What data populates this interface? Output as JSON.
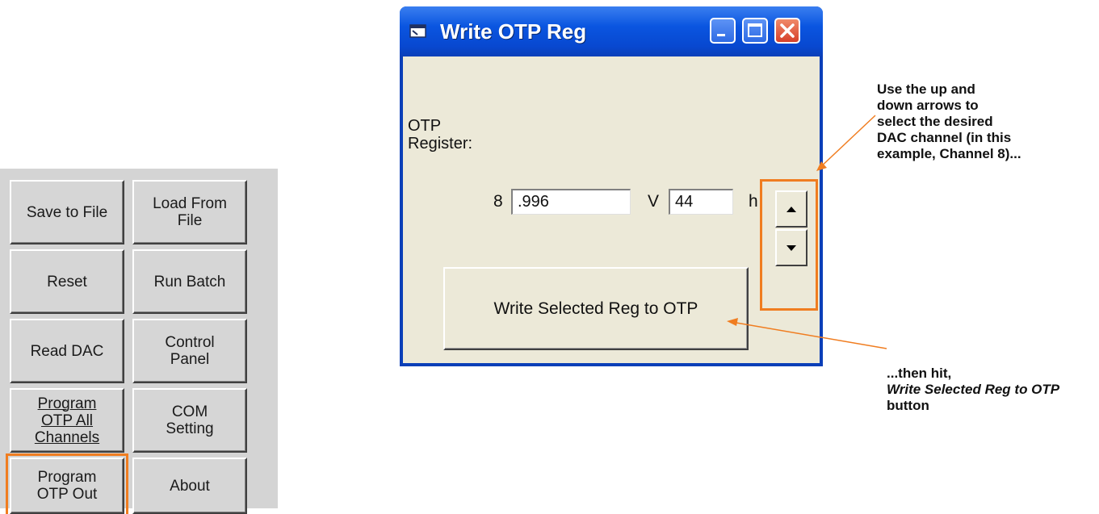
{
  "left_panel": {
    "buttons": [
      {
        "label": "Save to File"
      },
      {
        "label": "Load From\nFile"
      },
      {
        "label": "Reset"
      },
      {
        "label": "Run Batch"
      },
      {
        "label": "Read DAC"
      },
      {
        "label": "Control\nPanel"
      },
      {
        "label": "Program\nOTP All\nChannels"
      },
      {
        "label": "COM\nSetting"
      },
      {
        "label": "Program\nOTP Out"
      },
      {
        "label": "About"
      }
    ]
  },
  "dialog": {
    "title": "Write OTP Reg",
    "otp_label": "OTP\nRegister:",
    "channel": "8",
    "voltage_value": ".996",
    "voltage_unit": "V",
    "hex_value": "44",
    "hex_unit": "h",
    "write_button_label": "Write Selected Reg to OTP"
  },
  "annotations": {
    "arrows_note": "Use the up and\ndown arrows to\nselect the desired\nDAC channel (in this\nexample, Channel 8)...",
    "button_note_prefix": "...then hit,",
    "button_note_emphasis": "Write Selected Reg to OTP",
    "button_note_suffix": "button"
  },
  "colors": {
    "highlight": "#f07d20",
    "titlebar": "#0a55e0",
    "dialog_bg": "#ece9d8"
  }
}
